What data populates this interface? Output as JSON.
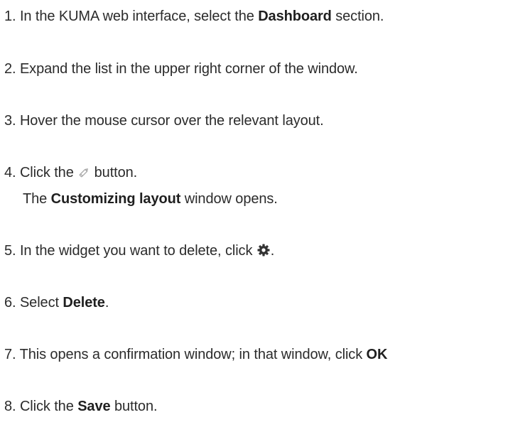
{
  "steps": [
    {
      "number": "1.",
      "pre": " In the KUMA web interface, select the ",
      "bold": "Dashboard",
      "post": " section."
    },
    {
      "number": "2.",
      "pre": " Expand the list in the upper right corner of the window."
    },
    {
      "number": "3.",
      "pre": " Hover the mouse cursor over the relevant layout."
    },
    {
      "number": "4.",
      "pre": " Click the ",
      "icon": "pencil-icon",
      "post": " button."
    },
    {
      "number": "5.",
      "pre": " In the widget you want to delete, click ",
      "icon": "gear-icon",
      "post": "."
    },
    {
      "number": "6.",
      "pre": " Select ",
      "bold": "Delete",
      "post": "."
    },
    {
      "number": "7.",
      "pre": " This opens a confirmation window; in that window, click ",
      "bold": "OK"
    },
    {
      "number": "8.",
      "pre": " Click the ",
      "bold": "Save",
      "post": " button."
    }
  ],
  "step4_note": {
    "pre": "The ",
    "bold": "Customizing layout",
    "post": " window opens."
  }
}
